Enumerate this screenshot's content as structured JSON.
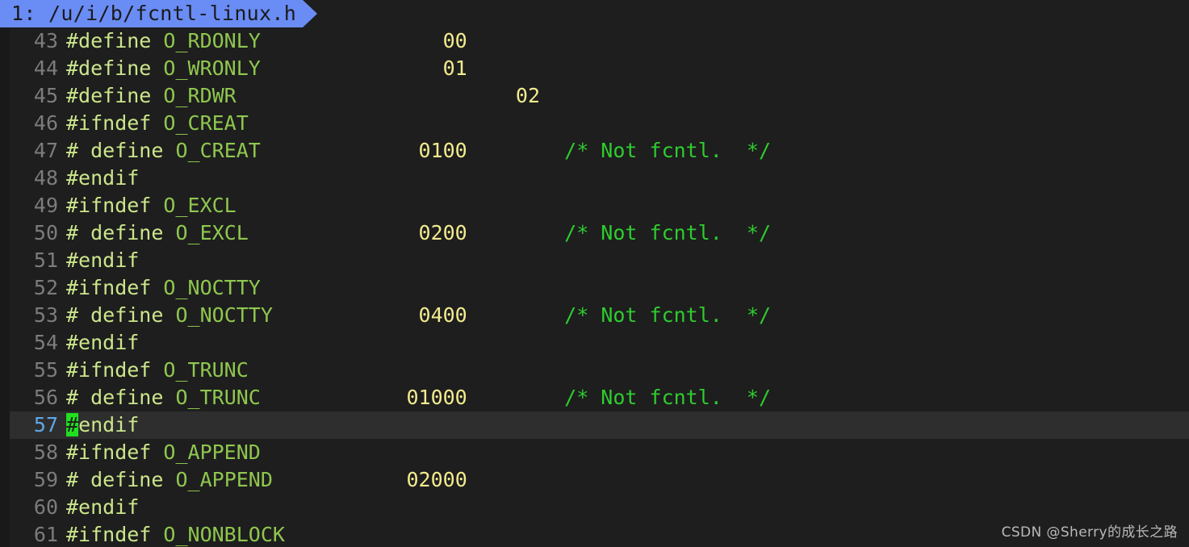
{
  "editor": {
    "name": "vim",
    "colors": {
      "background": "#1e1e1e",
      "gutter_fg": "#7c7c7c",
      "cursorline_bg": "#2e2e2e",
      "cursorline_number_fg": "#5fa8e8",
      "cursor_bg": "#20e020",
      "tab_bg": "#6a8cf5",
      "tab_fg": "#1a1a1a",
      "preproc": "#cbe68b",
      "identifier": "#8fc74e",
      "number": "#f2eb8f",
      "comment": "#2ecc2e"
    }
  },
  "tabline": {
    "tabs": [
      {
        "label": "1: /u/i/b/fcntl-linux.h",
        "active": true
      }
    ]
  },
  "cursor": {
    "line": 57,
    "column": 1,
    "char": "#"
  },
  "buffer": {
    "filename": "fcntl-linux.h",
    "lines": [
      {
        "num": "43",
        "tokens": [
          {
            "t": "pre",
            "s": "#define"
          },
          {
            "t": "plain",
            "s": " "
          },
          {
            "t": "id",
            "s": "O_RDONLY"
          },
          {
            "t": "plain",
            "s": "\t       "
          },
          {
            "t": "num",
            "s": "00"
          }
        ]
      },
      {
        "num": "44",
        "tokens": [
          {
            "t": "pre",
            "s": "#define"
          },
          {
            "t": "plain",
            "s": " "
          },
          {
            "t": "id",
            "s": "O_WRONLY"
          },
          {
            "t": "plain",
            "s": "\t       "
          },
          {
            "t": "num",
            "s": "01"
          }
        ]
      },
      {
        "num": "45",
        "tokens": [
          {
            "t": "pre",
            "s": "#define"
          },
          {
            "t": "plain",
            "s": " "
          },
          {
            "t": "id",
            "s": "O_RDWR"
          },
          {
            "t": "plain",
            "s": "\t\t       "
          },
          {
            "t": "num",
            "s": "02"
          }
        ]
      },
      {
        "num": "46",
        "tokens": [
          {
            "t": "pre",
            "s": "#ifndef"
          },
          {
            "t": "plain",
            "s": " "
          },
          {
            "t": "id",
            "s": "O_CREAT"
          }
        ]
      },
      {
        "num": "47",
        "tokens": [
          {
            "t": "pre",
            "s": "# define"
          },
          {
            "t": "plain",
            "s": " "
          },
          {
            "t": "id",
            "s": "O_CREAT"
          },
          {
            "t": "plain",
            "s": "\t     "
          },
          {
            "t": "num",
            "s": "0100"
          },
          {
            "t": "plain",
            "s": "\t"
          },
          {
            "t": "cmt",
            "s": "/* Not fcntl.  */"
          }
        ]
      },
      {
        "num": "48",
        "tokens": [
          {
            "t": "pre",
            "s": "#endif"
          }
        ]
      },
      {
        "num": "49",
        "tokens": [
          {
            "t": "pre",
            "s": "#ifndef"
          },
          {
            "t": "plain",
            "s": " "
          },
          {
            "t": "id",
            "s": "O_EXCL"
          }
        ]
      },
      {
        "num": "50",
        "tokens": [
          {
            "t": "pre",
            "s": "# define"
          },
          {
            "t": "plain",
            "s": " "
          },
          {
            "t": "id",
            "s": "O_EXCL"
          },
          {
            "t": "plain",
            "s": "\t      "
          },
          {
            "t": "num",
            "s": "0200"
          },
          {
            "t": "plain",
            "s": "\t"
          },
          {
            "t": "cmt",
            "s": "/* Not fcntl.  */"
          }
        ]
      },
      {
        "num": "51",
        "tokens": [
          {
            "t": "pre",
            "s": "#endif"
          }
        ]
      },
      {
        "num": "52",
        "tokens": [
          {
            "t": "pre",
            "s": "#ifndef"
          },
          {
            "t": "plain",
            "s": " "
          },
          {
            "t": "id",
            "s": "O_NOCTTY"
          }
        ]
      },
      {
        "num": "53",
        "tokens": [
          {
            "t": "pre",
            "s": "# define"
          },
          {
            "t": "plain",
            "s": " "
          },
          {
            "t": "id",
            "s": "O_NOCTTY"
          },
          {
            "t": "plain",
            "s": "\t    "
          },
          {
            "t": "num",
            "s": "0400"
          },
          {
            "t": "plain",
            "s": "\t"
          },
          {
            "t": "cmt",
            "s": "/* Not fcntl.  */"
          }
        ]
      },
      {
        "num": "54",
        "tokens": [
          {
            "t": "pre",
            "s": "#endif"
          }
        ]
      },
      {
        "num": "55",
        "tokens": [
          {
            "t": "pre",
            "s": "#ifndef"
          },
          {
            "t": "plain",
            "s": " "
          },
          {
            "t": "id",
            "s": "O_TRUNC"
          }
        ]
      },
      {
        "num": "56",
        "tokens": [
          {
            "t": "pre",
            "s": "# define"
          },
          {
            "t": "plain",
            "s": " "
          },
          {
            "t": "id",
            "s": "O_TRUNC"
          },
          {
            "t": "plain",
            "s": "\t    "
          },
          {
            "t": "num",
            "s": "01000"
          },
          {
            "t": "plain",
            "s": "\t"
          },
          {
            "t": "cmt",
            "s": "/* Not fcntl.  */"
          }
        ]
      },
      {
        "num": "57",
        "cursorline": true,
        "tokens": [
          {
            "t": "cursor",
            "s": "#"
          },
          {
            "t": "pre",
            "s": "endif"
          }
        ]
      },
      {
        "num": "58",
        "tokens": [
          {
            "t": "pre",
            "s": "#ifndef"
          },
          {
            "t": "plain",
            "s": " "
          },
          {
            "t": "id",
            "s": "O_APPEND"
          }
        ]
      },
      {
        "num": "59",
        "tokens": [
          {
            "t": "pre",
            "s": "# define"
          },
          {
            "t": "plain",
            "s": " "
          },
          {
            "t": "id",
            "s": "O_APPEND"
          },
          {
            "t": "plain",
            "s": "\t   "
          },
          {
            "t": "num",
            "s": "02000"
          }
        ]
      },
      {
        "num": "60",
        "tokens": [
          {
            "t": "pre",
            "s": "#endif"
          }
        ]
      },
      {
        "num": "61",
        "tokens": [
          {
            "t": "pre",
            "s": "#ifndef"
          },
          {
            "t": "plain",
            "s": " "
          },
          {
            "t": "id",
            "s": "O_NONBLOCK"
          }
        ]
      }
    ]
  },
  "watermark": {
    "text": "CSDN @Sherry的成长之路"
  }
}
